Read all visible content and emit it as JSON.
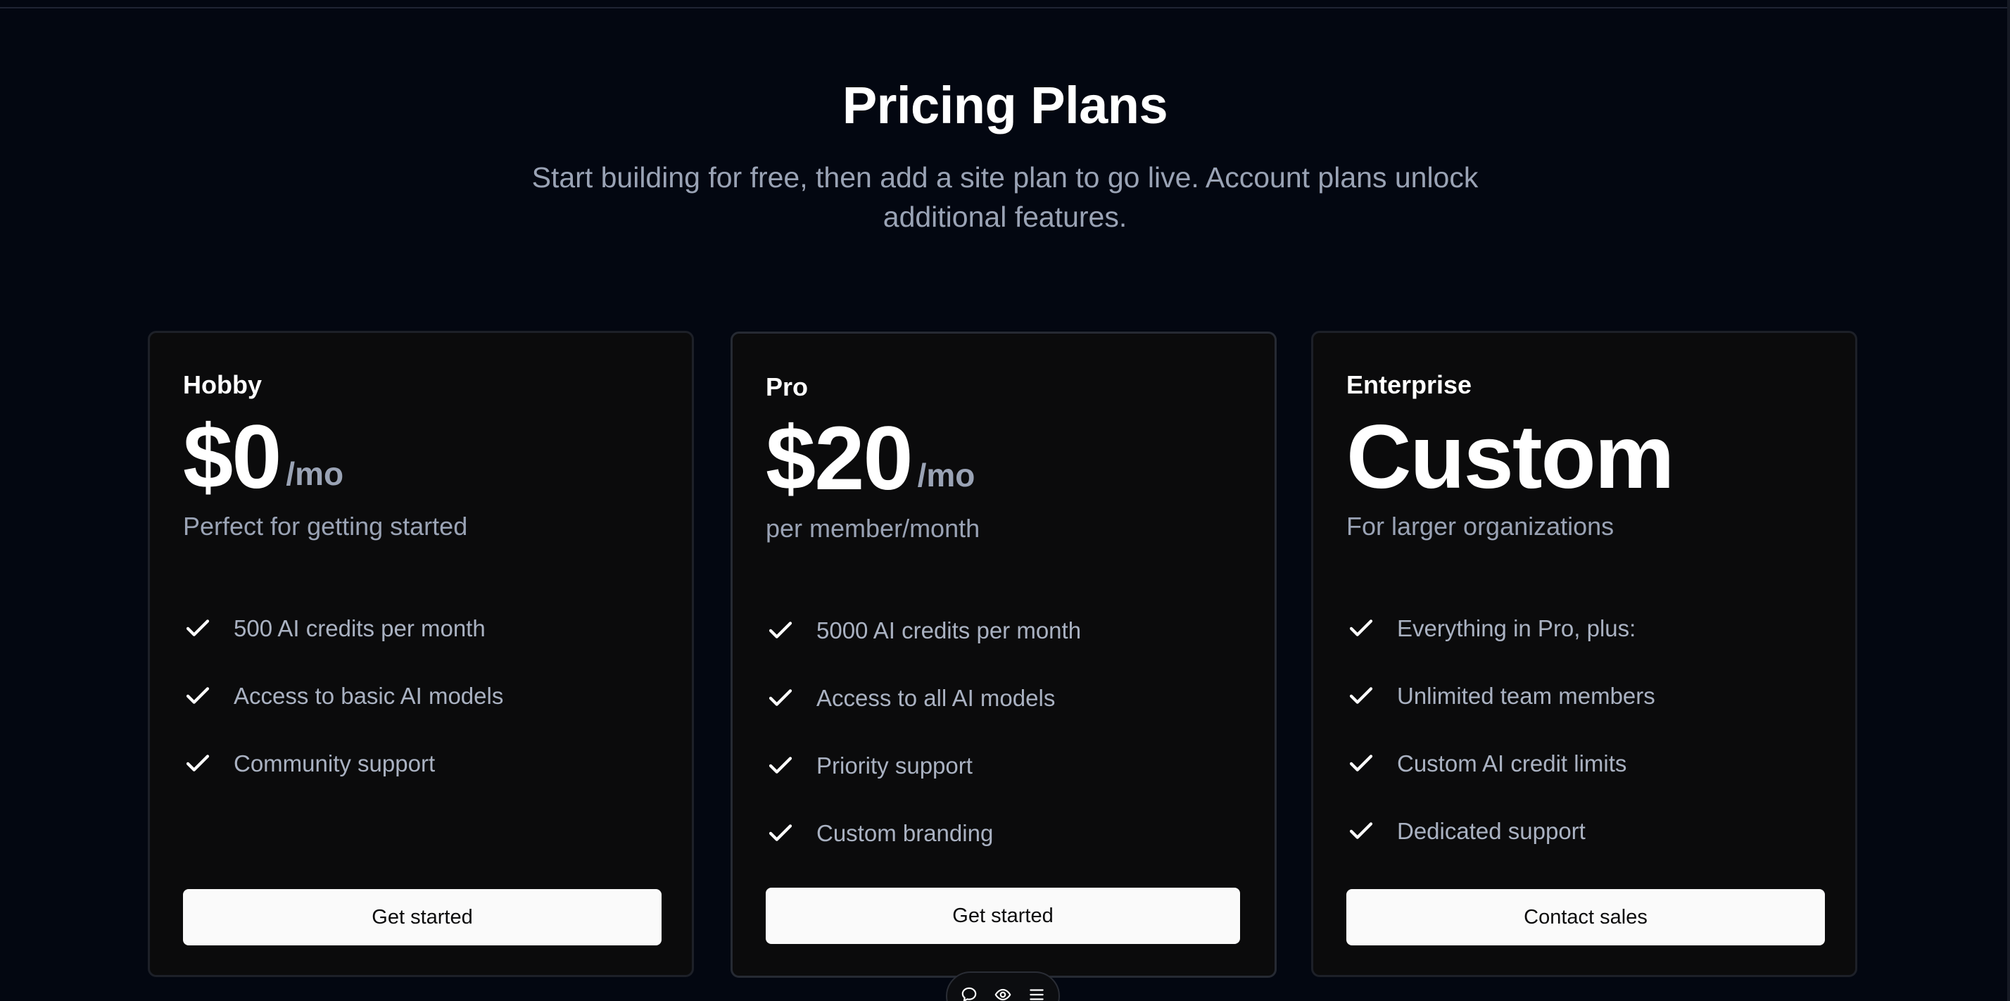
{
  "header": {
    "title": "Pricing Plans",
    "subtitle": "Start building for free, then add a site plan to go live. Account plans unlock additional features."
  },
  "plans": [
    {
      "name": "Hobby",
      "price": "$0",
      "period": "/mo",
      "description": "Perfect for getting started",
      "features": [
        "500 AI credits per month",
        "Access to basic AI models",
        "Community support"
      ],
      "cta": "Get started"
    },
    {
      "name": "Pro",
      "price": "$20",
      "period": "/mo",
      "description": "per member/month",
      "features": [
        "5000 AI credits per month",
        "Access to all AI models",
        "Priority support",
        "Custom branding"
      ],
      "cta": "Get started"
    },
    {
      "name": "Enterprise",
      "price": "Custom",
      "period": "",
      "description": "For larger organizations",
      "features": [
        "Everything in Pro, plus:",
        "Unlimited team members",
        "Custom AI credit limits",
        "Dedicated support"
      ],
      "cta": "Contact sales"
    }
  ],
  "toolbar": {
    "icons": [
      "comment-icon",
      "eye-icon",
      "menu-icon"
    ]
  },
  "colors": {
    "background": "#030711",
    "card": "#0b0b0c",
    "muted_text": "#9aa3b5",
    "button": "#fafafa"
  }
}
